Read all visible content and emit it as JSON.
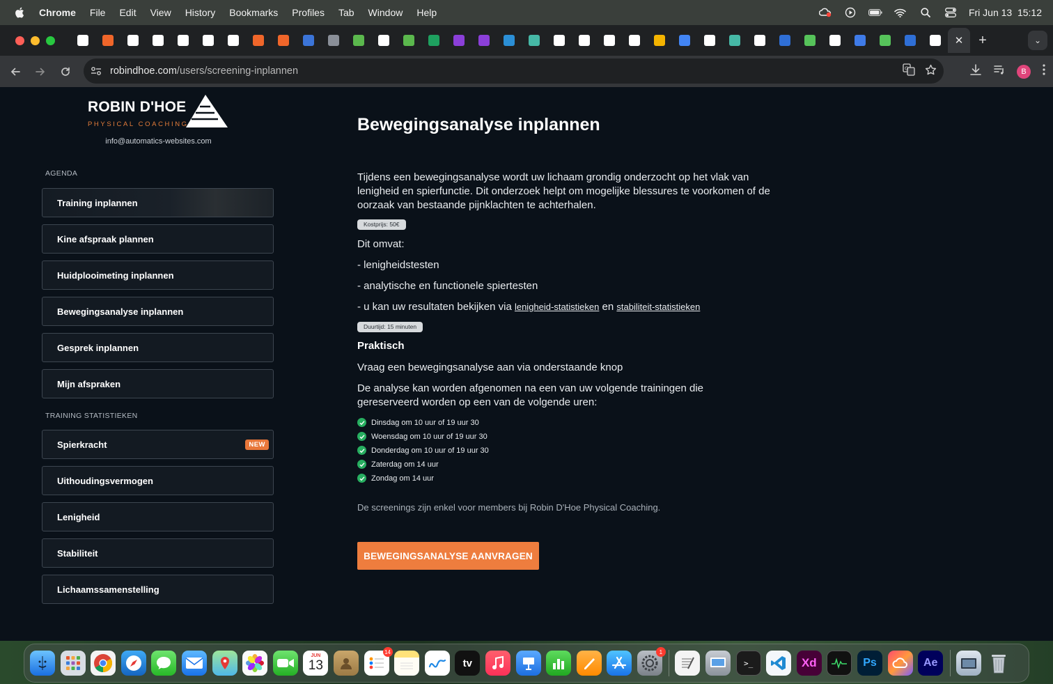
{
  "menubar": {
    "app_name": "Chrome",
    "items": [
      "File",
      "Edit",
      "View",
      "History",
      "Bookmarks",
      "Profiles",
      "Tab",
      "Window",
      "Help"
    ],
    "clock": "Fri Jun 13  15:12"
  },
  "browser": {
    "url_host": "robindhoe.com",
    "url_path": "/users/screening-inplannen",
    "profile_initial": "B",
    "pinned_tab_colors": [
      "#ffffff",
      "#f0662a",
      "#ffffff",
      "#ffffff",
      "#ffffff",
      "#ffffff",
      "#ffffff",
      "#f0662a",
      "#f0662a",
      "#3b74d8",
      "#8a8f98",
      "#5bb84d",
      "#ffffff",
      "#5bb84d",
      "#1ea05f",
      "#8b3fd9",
      "#8b3fd9",
      "#2b8fd6",
      "#46b8a6",
      "#ffffff",
      "#ffffff",
      "#ffffff",
      "#ffffff",
      "#f4b400",
      "#4285f4",
      "#ffffff",
      "#46b8a6",
      "#ffffff",
      "#2f6fd6",
      "#56c35a",
      "#ffffff",
      "#3f7be8",
      "#56c35a",
      "#2f6fd6",
      "#ffffff"
    ]
  },
  "sidebar": {
    "logo_main": "ROBIN D'HOE",
    "logo_sub": "PHYSICAL COACHING",
    "email": "info@automatics-websites.com",
    "agenda_label": "AGENDA",
    "agenda_items": [
      "Training inplannen",
      "Kine afspraak plannen",
      "Huidplooimeting inplannen",
      "Bewegingsanalyse inplannen",
      "Gesprek inplannen",
      "Mijn afspraken"
    ],
    "stats_label": "TRAINING STATISTIEKEN",
    "stats_items": [
      "Spierkracht",
      "Uithoudingsvermogen",
      "Lenigheid",
      "Stabiliteit",
      "Lichaamssamenstelling"
    ],
    "new_badge": "NEW"
  },
  "main": {
    "title": "Bewegingsanalyse inplannen",
    "intro": "Tijdens een bewegingsanalyse wordt uw lichaam grondig onderzocht op het vlak van lenigheid en spierfunctie. Dit onderzoek helpt om mogelijke blessures te voorkomen of de oorzaak van bestaande pijnklachten te achterhalen.",
    "price_pill": "Kostprijs: 50€",
    "includes_label": "Dit omvat:",
    "include_1": "- lenigheidstesten",
    "include_2": "- analytische en functionele spiertesten",
    "include_3_prefix": "- u kan uw resultaten bekijken via ",
    "link_1": "lenigheid-statistieken",
    "include_3_mid": " en ",
    "link_2": "stabiliteit-statistieken",
    "duration_pill": "Duurtijd: 15 minuten",
    "practical_heading": "Praktisch",
    "practical_1": "Vraag een bewegingsanalyse aan via onderstaande knop",
    "practical_2": "De analyse kan worden afgenomen na een van uw volgende trainingen die gereserveerd worden op een van de volgende uren:",
    "slots": [
      "Dinsdag om 10 uur of 19 uur 30",
      "Woensdag om 10 uur of 19 uur 30",
      "Donderdag om 10 uur of 19 uur 30",
      "Zaterdag om 14 uur",
      "Zondag om 14 uur"
    ],
    "note": "De screenings zijn enkel voor members bij Robin D'Hoe Physical Coaching.",
    "cta_label": "BEWEGINGSANALYSE AANVRAGEN",
    "accent_color": "#ee7d3e",
    "check_color": "#27ae60"
  },
  "dock": {
    "calendar_month": "JUN",
    "calendar_day": "13",
    "reminders_badge": "14",
    "settings_badge": "1",
    "tv_label": "tv",
    "xd_label": "Xd",
    "ps_label": "Ps",
    "ae_label": "Ae"
  }
}
